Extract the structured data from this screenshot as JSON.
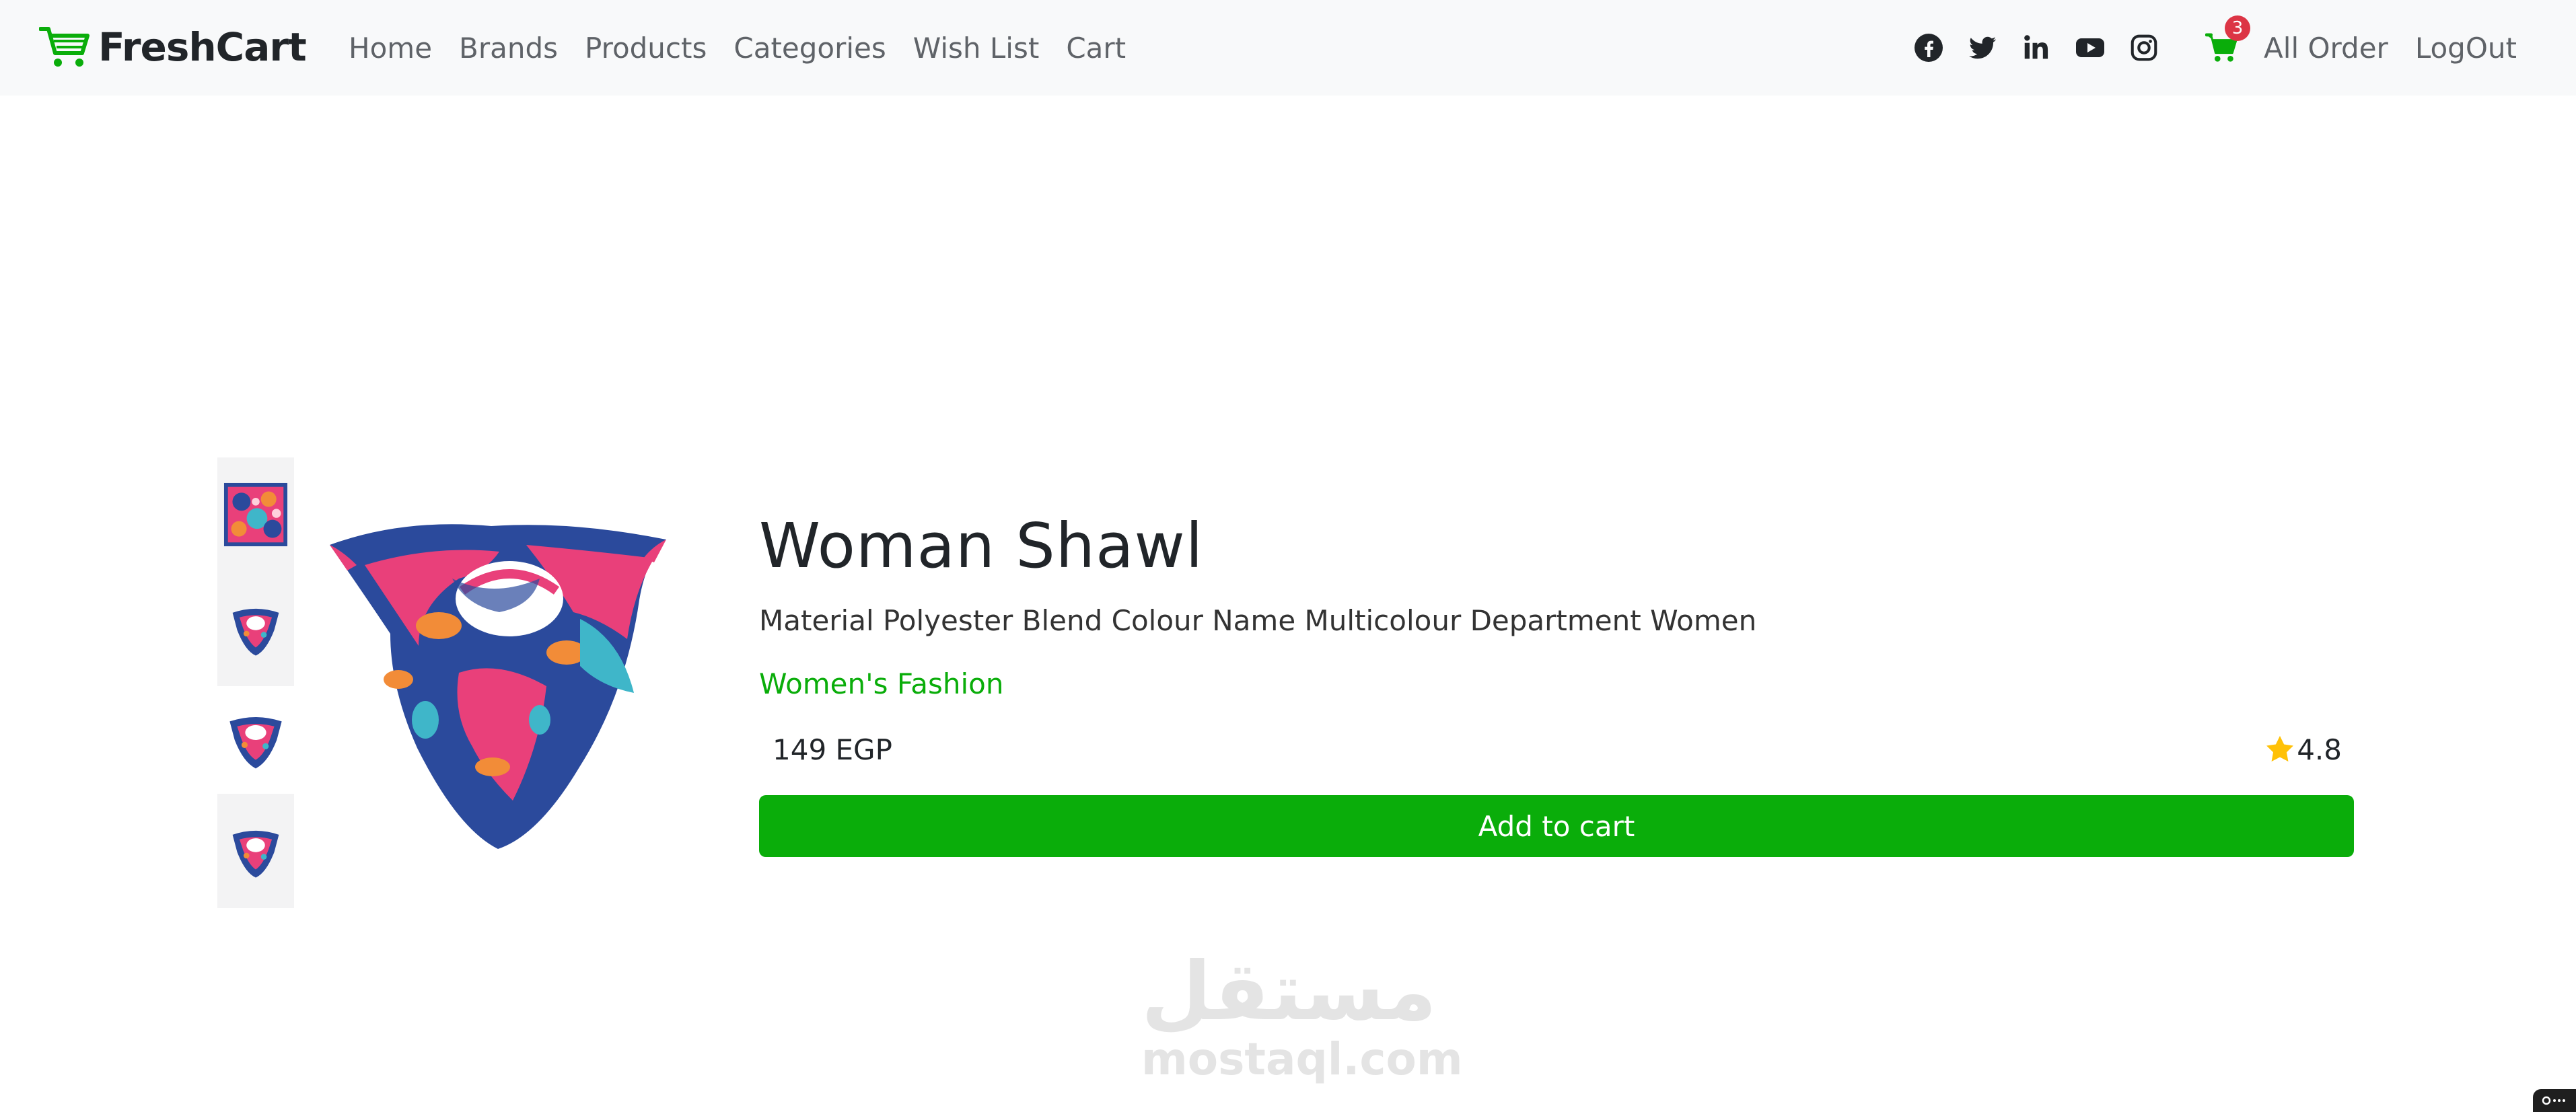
{
  "navbar": {
    "brand": "FreshCart",
    "links": [
      "Home",
      "Brands",
      "Products",
      "Categories",
      "Wish List",
      "Cart"
    ],
    "social_icons": [
      "facebook-icon",
      "twitter-icon",
      "linkedin-icon",
      "youtube-icon",
      "instagram-icon"
    ],
    "cart_count": "3",
    "all_order": "All Order",
    "logout": "LogOut"
  },
  "product": {
    "title": "Woman Shawl",
    "description": "Material Polyester Blend Colour Name Multicolour Department Women",
    "category": "Women's Fashion",
    "price": "149 EGP",
    "rating": "4.8",
    "add_to_cart": "Add to cart",
    "thumbnail_count": 4
  },
  "watermark": {
    "arabic": "مستقل",
    "latin": "mostaql.com"
  },
  "colors": {
    "brand_green": "#0aad0a",
    "badge_red": "#dc3545",
    "navbar_bg": "#f8f9fa",
    "star_gold": "#ffc107"
  }
}
